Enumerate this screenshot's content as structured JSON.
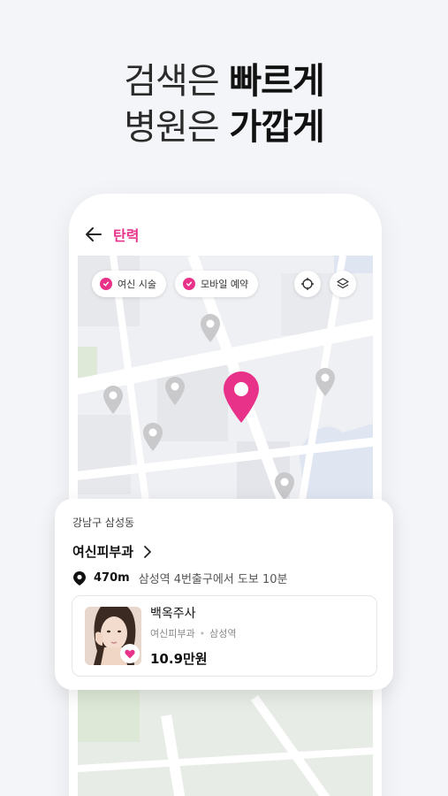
{
  "headline": {
    "line1_light": "검색은 ",
    "line1_bold": "빠르게",
    "line2_light": "병원은 ",
    "line2_bold": "가깝게"
  },
  "appbar": {
    "title": "탄력"
  },
  "map": {
    "chips": [
      {
        "label": "여신 시술",
        "checked": true
      },
      {
        "label": "모바일 예약",
        "checked": true
      }
    ],
    "accent_color": "#e8328a"
  },
  "card": {
    "district": "강남구 삼성동",
    "clinic_name": "여신피부과",
    "distance": "470m",
    "directions": "삼성역 4번출구에서 도보 10분",
    "product": {
      "name": "백옥주사",
      "clinic": "여신피부과",
      "station": "삼성역",
      "price": "10.9만원"
    }
  }
}
